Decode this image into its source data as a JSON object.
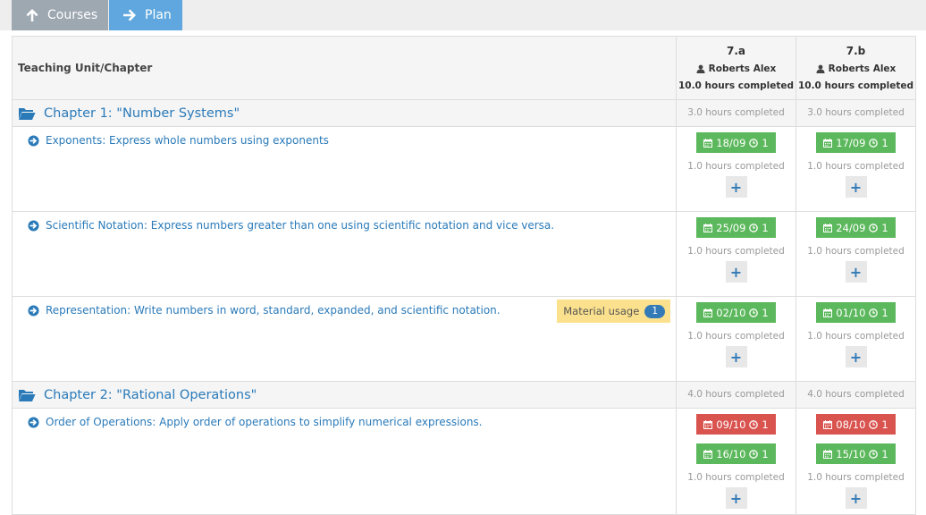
{
  "nav": {
    "courses_label": "Courses",
    "plan_label": "Plan"
  },
  "table": {
    "unit_header": "Teaching Unit/Chapter",
    "classes": [
      {
        "name": "7.a",
        "teacher": "Roberts Alex",
        "hours": "10.0 hours completed"
      },
      {
        "name": "7.b",
        "teacher": "Roberts Alex",
        "hours": "10.0 hours completed"
      }
    ]
  },
  "chapters": [
    {
      "title": "Chapter 1: \"Number Systems\"",
      "hours": [
        "3.0 hours completed",
        "3.0 hours completed"
      ],
      "lessons": [
        {
          "title": "Exponents: Express whole numbers using exponents",
          "cells": [
            {
              "dates": [
                {
                  "date": "18/09",
                  "count": "1",
                  "status": "green"
                }
              ],
              "hours": "1.0 hours completed"
            },
            {
              "dates": [
                {
                  "date": "17/09",
                  "count": "1",
                  "status": "green"
                }
              ],
              "hours": "1.0 hours completed"
            }
          ]
        },
        {
          "title": "Scientific Notation: Express numbers greater than one using scientific notation and vice versa.",
          "cells": [
            {
              "dates": [
                {
                  "date": "25/09",
                  "count": "1",
                  "status": "green"
                }
              ],
              "hours": "1.0 hours completed"
            },
            {
              "dates": [
                {
                  "date": "24/09",
                  "count": "1",
                  "status": "green"
                }
              ],
              "hours": "1.0 hours completed"
            }
          ]
        },
        {
          "title": "Representation: Write numbers in word, standard, expanded, and scientific notation.",
          "material_label": "Material usage",
          "material_count": "1",
          "cells": [
            {
              "dates": [
                {
                  "date": "02/10",
                  "count": "1",
                  "status": "green"
                }
              ],
              "hours": "1.0 hours completed"
            },
            {
              "dates": [
                {
                  "date": "01/10",
                  "count": "1",
                  "status": "green"
                }
              ],
              "hours": "1.0 hours completed"
            }
          ]
        }
      ]
    },
    {
      "title": "Chapter 2: \"Rational Operations\"",
      "hours": [
        "4.0 hours completed",
        "4.0 hours completed"
      ],
      "lessons": [
        {
          "title": "Order of Operations: Apply order of operations to simplify numerical expressions.",
          "cells": [
            {
              "dates": [
                {
                  "date": "09/10",
                  "count": "1",
                  "status": "red"
                },
                {
                  "date": "16/10",
                  "count": "1",
                  "status": "green"
                }
              ],
              "hours": "1.0 hours completed"
            },
            {
              "dates": [
                {
                  "date": "08/10",
                  "count": "1",
                  "status": "red"
                },
                {
                  "date": "15/10",
                  "count": "1",
                  "status": "green"
                }
              ],
              "hours": "1.0 hours completed"
            }
          ]
        }
      ]
    }
  ],
  "add_label": "+",
  "colors": {
    "green": "#5cb85c",
    "red": "#d9534f",
    "link": "#2a7ab9",
    "material": "#fbe18d"
  }
}
